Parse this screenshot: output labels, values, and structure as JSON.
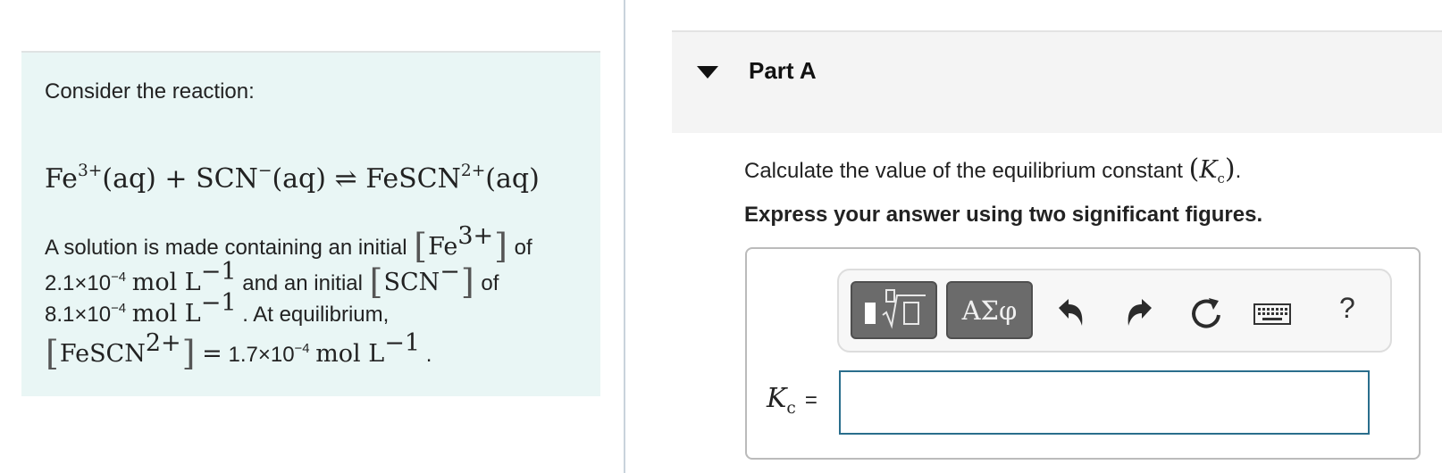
{
  "problem": {
    "intro": "Consider the reaction:",
    "reaction": {
      "reactant1": "Fe",
      "reactant1_charge": "3+",
      "phase": "(aq)",
      "plus": "+",
      "reactant2": "SCN",
      "reactant2_charge": "−",
      "arrow": "⇌",
      "product": "FeSCN",
      "product_charge": "2+"
    },
    "lines": {
      "l1_text": "A solution is made containing an initial",
      "l1_species": "Fe",
      "l1_charge": "3+",
      "l1_end": "of",
      "l2_value": "2.1×10",
      "l2_exp": "−4",
      "l2_unit": "mol L",
      "l2_unit_exp": "−1",
      "l2_text": "and an initial",
      "l2_species": "SCN",
      "l2_charge": "−",
      "l2_end": "of",
      "l3_value": "8.1×10",
      "l3_exp": "−4",
      "l3_unit": "mol L",
      "l3_unit_exp": "−1",
      "l3_text": ". At equilibrium,",
      "l4_species": "FeSCN",
      "l4_charge": "2+",
      "l4_eq": "=",
      "l4_value": "1.7×10",
      "l4_exp": "−4",
      "l4_unit": "mol L",
      "l4_unit_exp": "−1",
      "l4_end": "."
    }
  },
  "part": {
    "title": "Part A",
    "question_text": "Calculate the value of the equilibrium constant",
    "constant_symbol": "K",
    "constant_sub": "c",
    "instruction": "Express your answer using two significant figures."
  },
  "toolbar": {
    "templates_icon": "templates-radical-icon",
    "symbols_label": "ΑΣφ",
    "undo_icon": "undo-icon",
    "redo_icon": "redo-icon",
    "reset_icon": "reset-icon",
    "keyboard_icon": "keyboard-icon",
    "help_label": "?"
  },
  "answer": {
    "label_symbol": "K",
    "label_sub": "c",
    "equals": "=",
    "value": "",
    "placeholder": ""
  },
  "colors": {
    "problem_bg": "#e9f6f5",
    "part_header_bg": "#f4f4f4",
    "toolbar_button": "#6b6b6b",
    "input_border": "#2a6e8c"
  }
}
